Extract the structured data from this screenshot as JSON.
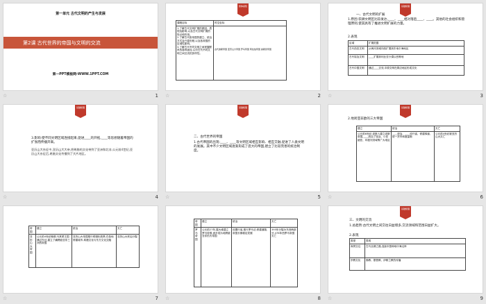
{
  "slides": [
    {
      "num": "1",
      "unit_title": "第一单元 古代文明的产生与发展",
      "lesson_title": "第2课 古代世界的帝国与文明的交流",
      "watermark": "第一PPT模板网-WWW.1PPT.COM"
    },
    {
      "num": "2",
      "tag": "整体感知",
      "headers": [
        "课程目标",
        "时空坐标"
      ],
      "goals": "1.了解古代文明扩展的原因、表现及影响,以及古代文明扩展的特点和作用。\n2.了解古代各帝国的建立、统治方式及兴衰历程,以及各帝国的区域性影响。\n3.了解古代不同文明之间掌握联系的各种途径,认识古代不同文明之间交流的多样性。",
      "timeline": "古代波斯帝国 亚历山大帝国 罗马帝国 阿拉伯帝国 奥斯曼帝国"
    },
    {
      "num": "3",
      "tag": "基础梳理",
      "heading": "一、古代文明的扩展",
      "p1": "1.原因:农耕文明区比较发达,____、____相对落后____、____。其他的社会组织和管理原则,使其具有了推进文明扩展的力量。",
      "p2": "2.表现",
      "col1": [
        "区域",
        "古代西亚文明",
        "古代埃及文明",
        "古代中国文明"
      ],
      "col2": [
        "扩展范围",
        "从两河流域向西扩展到东地中海地区",
        "____扩展到利比亚沙漠以西等地",
        "通过____交流,中原文明在周边地区形成文化"
      ]
    },
    {
      "num": "4",
      "tag": "基础梳理",
      "p1": "3.影响:使不同文明区域连接起来,促进____的开拓,____等思想随着帝国的扩张而传播开来。",
      "p2": "亚历山大东征中,亚历山大大帝,把希腊的文化带到了亚洲和北非,公元前4世纪,亚历山大东征后,希腊文化传播到了大片地区。"
    },
    {
      "num": "5",
      "tag": "基础梳理",
      "heading": "二、古代世界的帝国",
      "p1": "1.古代帝国的出现:____、____等文明区域相互影响、相互交融,促进了人类文明的发展。其中不少文明区域逐渐形成了庞大的帝国,建立了比较完善的统治制度。"
    },
    {
      "num": "6",
      "tag": "基础梳理",
      "heading": "2.地跨亚非欧的三大帝国",
      "cols": [
        "建立",
        "统治",
        "灭亡"
      ],
      "row": [
        "公元前6世纪,波斯人建立波斯帝国,____统治了埃及、小亚细亚、印度河流域等广大地区",
        "____统治、____设行省、修建驿道、统一货币和度量衡",
        "公元前4世纪被亚历山大灭亡"
      ]
    },
    {
      "num": "7",
      "cols": [
        "帝国",
        "建立",
        "统治",
        "灭亡"
      ],
      "name": "亚历山大帝国",
      "row": [
        "公元前4世纪晚期,马其顿王国通过东征,建立了横跨欧亚非三洲的帝国",
        "亚历山大帝国推行希腊化政策,在各地修建城市,希腊文化与东方文化交融",
        "亚历山大死后分裂"
      ]
    },
    {
      "num": "8",
      "cols": [
        "帝国",
        "建立",
        "统治",
        "灭亡"
      ],
      "name": "罗马帝国",
      "row": [
        "公元前27年,屋大维建立罗马帝国,逐步成为地跨欧亚非的大帝国",
        "设置行省,推行罗马法,修建道路,帝国长期稳定发展",
        "395年分裂为东西两部分,476年西罗马帝国灭亡"
      ]
    },
    {
      "num": "9",
      "tag": "基础梳理",
      "heading": "三、文明的交流",
      "p1": "1.总趋势:古代文明之间交往日益增多,交流领域和范围日益扩大。",
      "p2": "2.表现",
      "rows": [
        [
          "类型",
          "表现"
        ],
        [
          "商贸交往",
          "古代丝绸之路,连接中国和地中海沿岸"
        ],
        [
          "宗教文化",
          "佛教、基督教、伊斯兰教的传播"
        ]
      ]
    }
  ]
}
